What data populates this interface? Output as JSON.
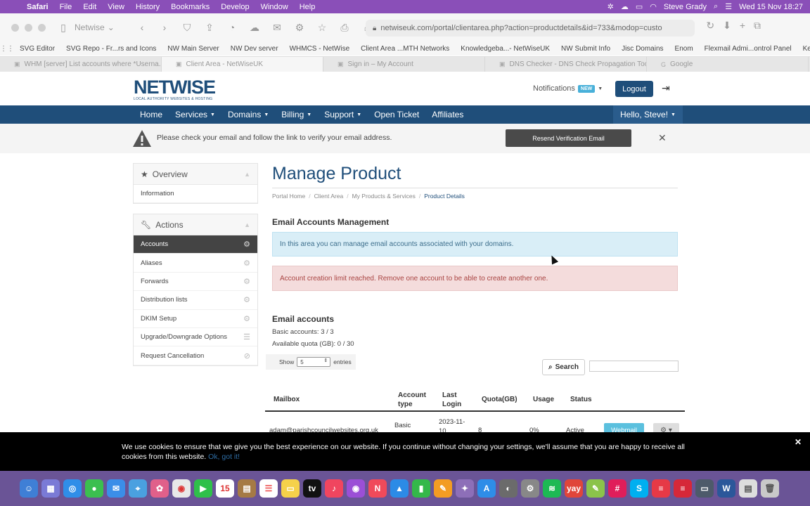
{
  "menubar": {
    "items": [
      "Safari",
      "File",
      "Edit",
      "View",
      "History",
      "Bookmarks",
      "Develop",
      "Window",
      "Help"
    ],
    "user": "Steve Grady",
    "datetime": "Wed 15 Nov  18:27"
  },
  "toolbar": {
    "tab_group": "Netwise",
    "url": "netwiseuk.com/portal/clientarea.php?action=productdetails&id=733&modop=custo"
  },
  "bookmarks": [
    "SVG Editor",
    "SVG Repo - Fr...rs and Icons",
    "NW Main Server",
    "NW Dev server",
    "WHMCS - NetWise",
    "Client Area ...MTH Networks",
    "Knowledgeba...- NetWiseUK",
    "NW Submit Info",
    "Jisc Domains",
    "Enom",
    "Flexmail Admi...ontrol Panel",
    "Keighley VPS"
  ],
  "tabs": [
    {
      "label": "WHM [server] List accounts where *Userna...",
      "active": false
    },
    {
      "label": "Client Area - NetWiseUK",
      "active": true
    },
    {
      "label": "Sign in – My Account",
      "active": false
    },
    {
      "label": "DNS Checker - DNS Check Propagation Tool",
      "active": false
    },
    {
      "label": "Google",
      "active": false
    }
  ],
  "header": {
    "logo_a": "NET",
    "logo_b": "WISE",
    "logo_tag": "LOCAL AUTHORITY WEBSITES & HOSTING",
    "notifications": "Notifications",
    "new_badge": "NEW",
    "logout": "Logout"
  },
  "nav": {
    "items": [
      {
        "label": "Home",
        "caret": false
      },
      {
        "label": "Services",
        "caret": true
      },
      {
        "label": "Domains",
        "caret": true
      },
      {
        "label": "Billing",
        "caret": true
      },
      {
        "label": "Support",
        "caret": true
      },
      {
        "label": "Open Ticket",
        "caret": false
      },
      {
        "label": "Affiliates",
        "caret": false
      }
    ],
    "hello": "Hello, Steve!"
  },
  "verify": {
    "message": "Please check your email and follow the link to verify your email address.",
    "resend": "Resend Verification Email"
  },
  "sidebar": {
    "overview_title": "Overview",
    "overview_items": [
      "Information"
    ],
    "actions_title": "Actions",
    "actions_items": [
      {
        "label": "Accounts",
        "active": true,
        "icon": "gears-icon"
      },
      {
        "label": "Aliases",
        "active": false,
        "icon": "gears-icon"
      },
      {
        "label": "Forwards",
        "active": false,
        "icon": "gears-icon"
      },
      {
        "label": "Distribution lists",
        "active": false,
        "icon": "gears-icon"
      },
      {
        "label": "DKIM Setup",
        "active": false,
        "icon": "gears-icon"
      },
      {
        "label": "Upgrade/Downgrade Options",
        "active": false,
        "icon": "list-icon"
      },
      {
        "label": "Request Cancellation",
        "active": false,
        "icon": "ban-icon"
      }
    ]
  },
  "main": {
    "title": "Manage Product",
    "breadcrumb": [
      "Portal Home",
      "Client Area",
      "My Products & Services",
      "Product Details"
    ],
    "section_title": "Email Accounts Management",
    "info": "In this area you can manage email accounts associated with your domains.",
    "danger": "Account creation limit reached. Remove one account to be able to create another one.",
    "email_title": "Email accounts",
    "basic_label": "Basic accounts:",
    "basic_value": "3 / 3",
    "quota_label": "Available quota (GB):",
    "quota_value": "0 / 30",
    "show_label": "Show",
    "show_value": "5",
    "entries_label": "entries",
    "search_label": "Search",
    "columns": [
      "Mailbox",
      "Account type",
      "Last Login",
      "Quota(GB)",
      "Usage",
      "Status"
    ],
    "row": {
      "mailbox": "adam@parishcouncilwebsites.org.uk",
      "type": "Basic",
      "last_login": "2023-11-10",
      "quota": "8",
      "usage": "0%",
      "status": "Active",
      "webmail": "Webmail"
    }
  },
  "cookie": {
    "text": "We use cookies to ensure that we give you the best experience on our website. If you continue without changing your settings, we'll assume that you are happy to receive all cookies from this website.",
    "ok": "Ok, got it!"
  },
  "colors": {
    "brand": "#1f4e7a",
    "menubar": "#8a4fb8",
    "info": "#d9eef7",
    "danger": "#f4dcdc"
  }
}
